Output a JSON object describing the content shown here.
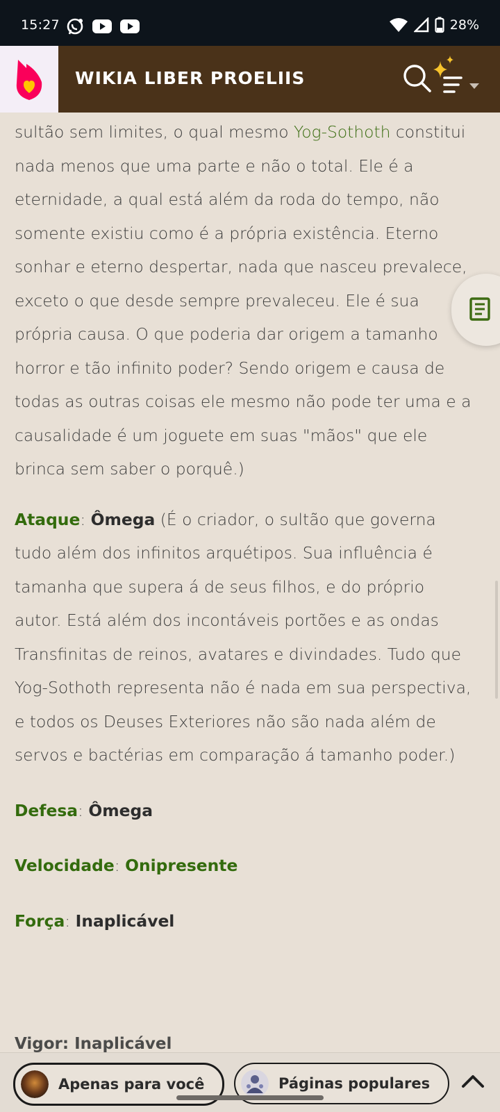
{
  "status_bar": {
    "time": "15:27",
    "battery": "28%"
  },
  "header": {
    "title": "WIKIA LIBER PROELIIS"
  },
  "content": {
    "p1": {
      "before_link": "sultão sem limites, o qual mesmo ",
      "link": "Yog-Sothoth",
      "after_link": " constitui nada menos que uma parte e não o total. Ele é a eternidade, a qual está além da roda do tempo, não somente existiu como é a própria existência. Eterno sonhar e eterno despertar, nada que nasceu prevalece, exceto o que desde sempre prevaleceu. Ele é sua própria causa. O que poderia dar origem a tamanho horror e tão infinito poder? Sendo origem e causa de todas as outras coisas ele mesmo não pode ter uma e a causalidade é um joguete em suas \"mãos\" que ele brinca sem saber o porquê.)"
    },
    "ataque": {
      "label": "Ataque",
      "value": "Ômega",
      "text": " (É o criador, o sultão que governa tudo além dos infinitos arquétipos. Sua influência é tamanha que supera á de seus filhos, e do próprio autor. Está além dos incontáveis portões e as ondas Transfinitas de reinos, avatares e divindades. Tudo que Yog-Sothoth representa não é nada em sua perspectiva, e todos os Deuses Exteriores não são nada além de servos e bactérias em comparação á tamanho poder.)"
    },
    "defesa": {
      "label": "Defesa",
      "value": "Ômega"
    },
    "velocidade": {
      "label": "Velocidade",
      "value": "Onipresente"
    },
    "forca": {
      "label": "Força",
      "value": "Inaplicável"
    },
    "next_partial": "Vigor: Inaplicável"
  },
  "bottom_bar": {
    "for_you": "Apenas para você",
    "popular": "Páginas populares"
  },
  "colors": {
    "header_bg": "#4a3219",
    "page_bg": "#e8e0d6",
    "link_green": "#3c6e13",
    "label_green": "#336b0d"
  },
  "icons": [
    "fandom-logo-icon",
    "search-icon",
    "menu-icon",
    "sparkle-icon",
    "chevron-down-icon",
    "toc-icon",
    "chevron-up-icon"
  ]
}
